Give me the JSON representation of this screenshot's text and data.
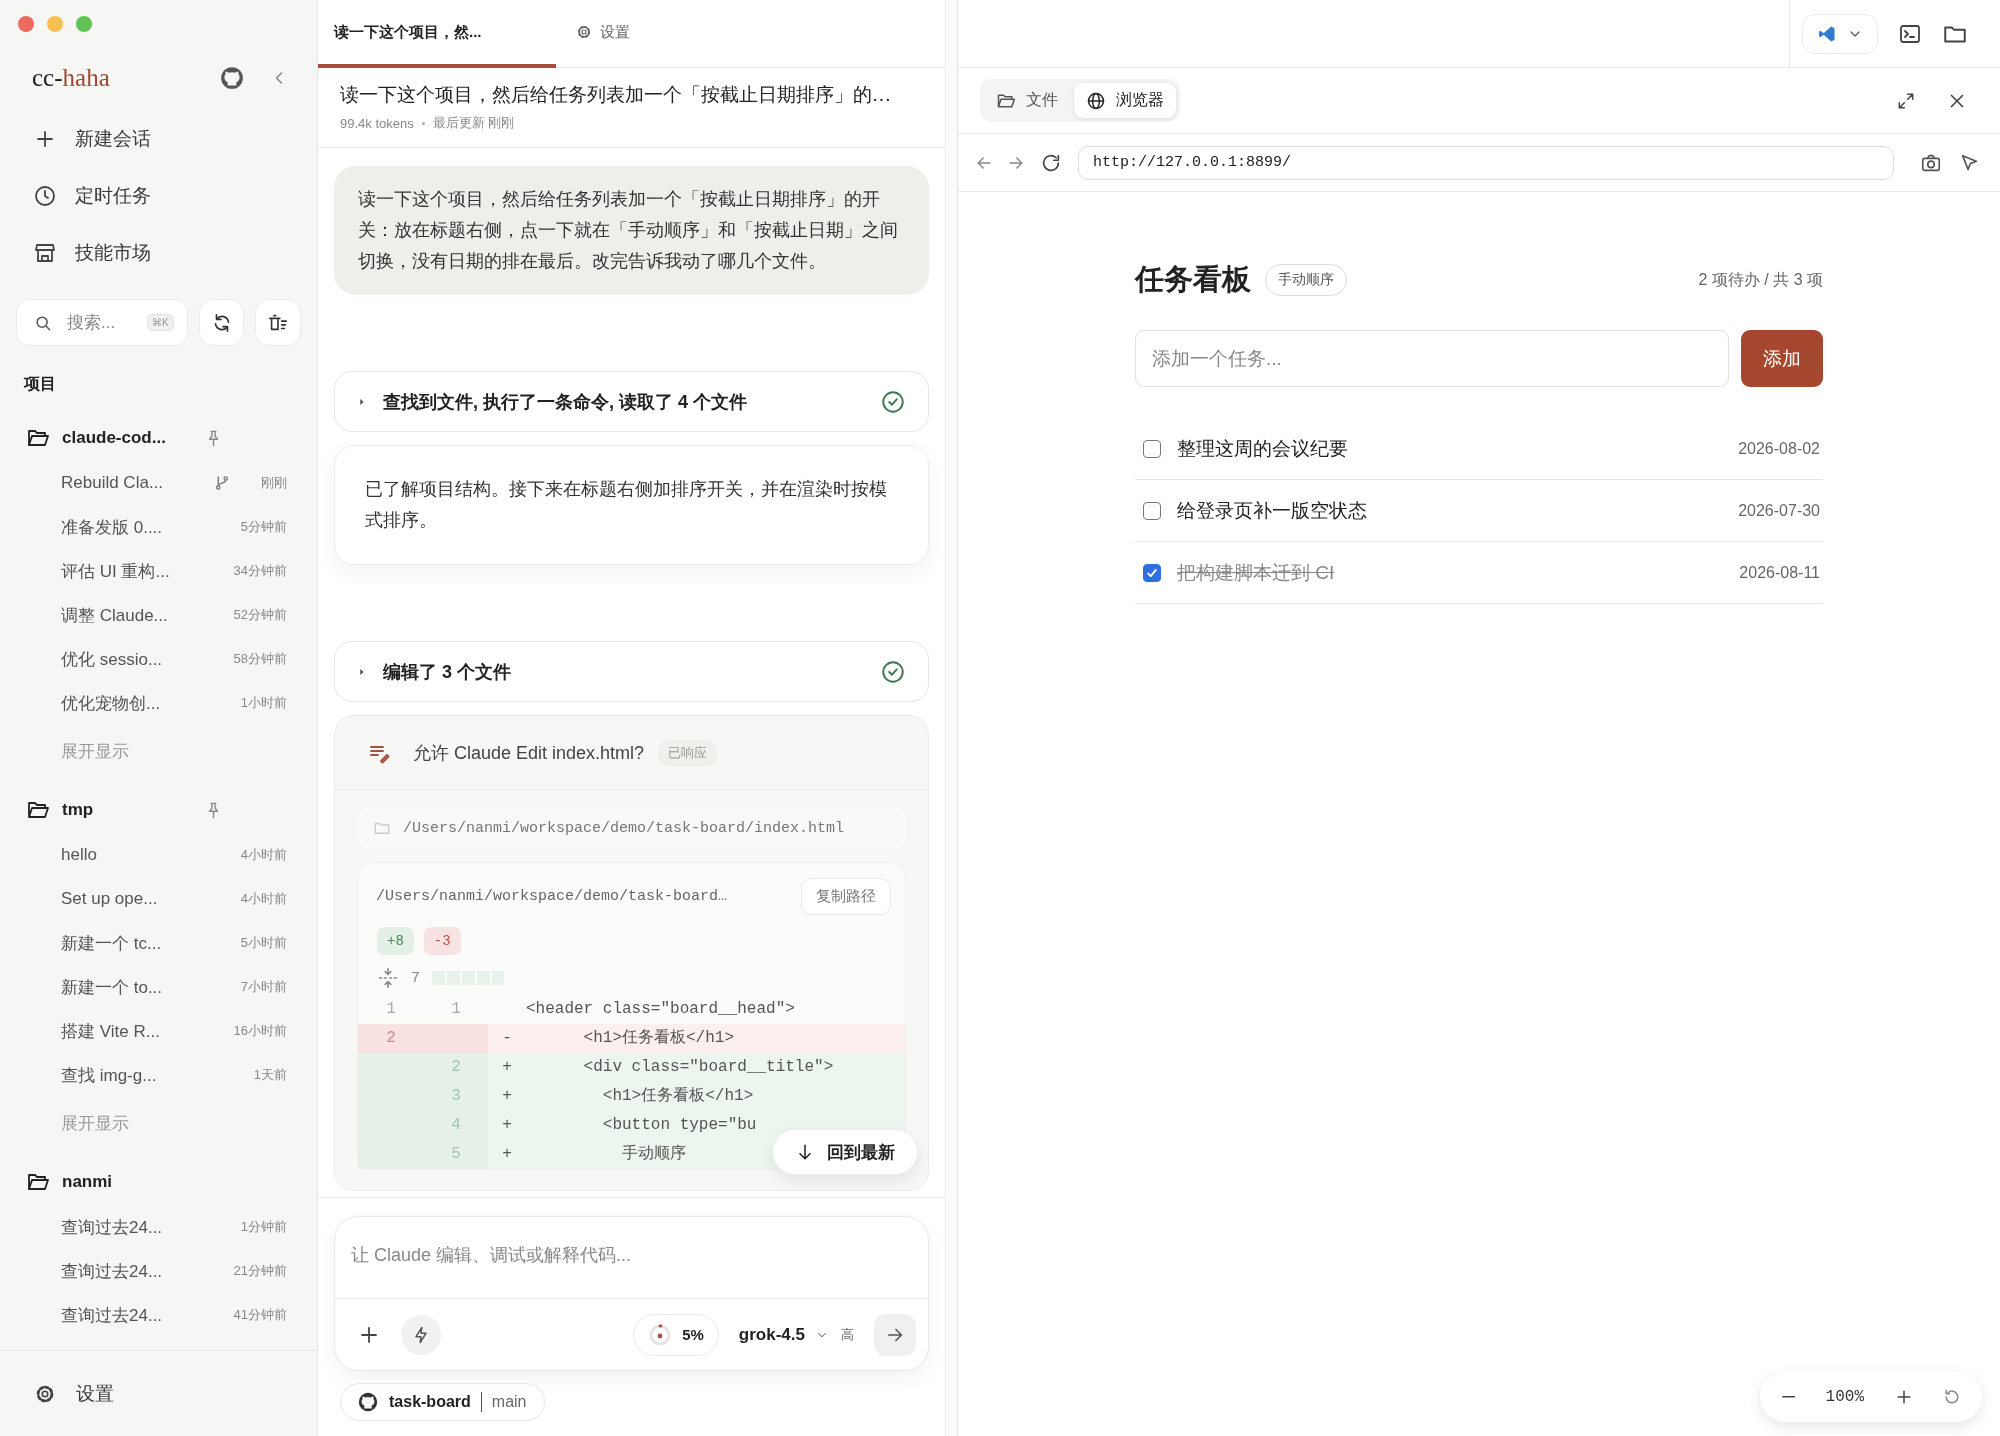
{
  "sidebar": {
    "brand": {
      "prefix": "cc-",
      "accent": "haha"
    },
    "nav": [
      {
        "kind": "new",
        "label": "新建会话"
      },
      {
        "kind": "schedule",
        "label": "定时任务"
      },
      {
        "kind": "market",
        "label": "技能市场"
      }
    ],
    "search": {
      "placeholder": "搜索...",
      "shortcut": "⌘K"
    },
    "section_title": "项目",
    "projects": [
      {
        "name": "claude-cod...",
        "pinned": true,
        "more": "展开显示",
        "sessions": [
          {
            "title": "Rebuild Cla...",
            "time": "刚刚",
            "branch": true
          },
          {
            "title": "准备发版 0....",
            "time": "5分钟前",
            "branch": false
          },
          {
            "title": "评估 UI 重构...",
            "time": "34分钟前",
            "branch": false
          },
          {
            "title": "调整 Claude...",
            "time": "52分钟前",
            "branch": false
          },
          {
            "title": "优化 sessio...",
            "time": "58分钟前",
            "branch": false
          },
          {
            "title": "优化宠物创...",
            "time": "1小时前",
            "branch": false
          }
        ]
      },
      {
        "name": "tmp",
        "pinned": true,
        "more": "展开显示",
        "sessions": [
          {
            "title": "hello",
            "time": "4小时前",
            "branch": false
          },
          {
            "title": "Set up ope...",
            "time": "4小时前",
            "branch": false
          },
          {
            "title": "新建一个 tc...",
            "time": "5小时前",
            "branch": false
          },
          {
            "title": "新建一个 to...",
            "time": "7小时前",
            "branch": false
          },
          {
            "title": "搭建 Vite R...",
            "time": "16小时前",
            "branch": false
          },
          {
            "title": "查找 img-g...",
            "time": "1天前",
            "branch": false
          }
        ]
      },
      {
        "name": "nanmi",
        "pinned": false,
        "sessions": [
          {
            "title": "查询过去24...",
            "time": "1分钟前",
            "branch": false
          },
          {
            "title": "查询过去24...",
            "time": "21分钟前",
            "branch": false
          },
          {
            "title": "查询过去24...",
            "time": "41分钟前",
            "branch": false
          }
        ]
      }
    ],
    "settings": "设置"
  },
  "tabs": [
    {
      "kind": "chat",
      "label": "读一下这个项目，然...",
      "selected": true
    },
    {
      "kind": "settings",
      "label": "设置",
      "selected": false
    }
  ],
  "chat": {
    "title": "读一下这个项目，然后给任务列表加一个「按截止日期排序」的…",
    "tokens": "99.4k tokens",
    "updated": "最后更新 刚刚",
    "messages": [
      {
        "kind": "user",
        "text": "读一下这个项目，然后给任务列表加一个「按截止日期排序」的开关：放在标题右侧，点一下就在「手动顺序」和「按截止日期」之间切换，没有日期的排在最后。改完告诉我动了哪几个文件。"
      },
      {
        "kind": "tool",
        "summary": "查找到文件, 执行了一条命令, 读取了 4 个文件",
        "done": true
      },
      {
        "kind": "assistant",
        "text": "已了解项目结构。接下来在标题右侧加排序开关，并在渲染时按模式排序。"
      },
      {
        "kind": "tool",
        "summary": "编辑了 3 个文件",
        "done": true
      },
      {
        "kind": "permission",
        "title": "允许 Claude Edit index.html?",
        "status": "已响应",
        "path": "/Users/nanmi/workspace/demo/task-board/index.html",
        "diff": {
          "path": "/Users/nanmi/workspace/demo/task-board…",
          "copy": "复制路径",
          "added": "+8",
          "removed": "-3",
          "hunk": "7",
          "lines": [
            {
              "kind": "context",
              "old": "1",
              "new": "1",
              "code": "<header class=\"board__head\">"
            },
            {
              "kind": "del",
              "old": "2",
              "sign": "-",
              "code": "      <h1>任务看板</h1>"
            },
            {
              "kind": "add",
              "new": "2",
              "sign": "+",
              "code": "      <div class=\"board__title\">"
            },
            {
              "kind": "add",
              "new": "3",
              "sign": "+",
              "code": "        <h1>任务看板</h1>"
            },
            {
              "kind": "add",
              "new": "4",
              "sign": "+",
              "code": "        <button type=\"bu"
            },
            {
              "kind": "add",
              "new": "5",
              "sign": "+",
              "code": "          手动顺序"
            }
          ]
        }
      }
    ],
    "jump": "回到最新"
  },
  "composer": {
    "placeholder": "让 Claude 编辑、调试或解释代码...",
    "context": "5%",
    "model": "grok-4.5",
    "effort": "高"
  },
  "repo": {
    "name": "task-board",
    "branch": "main"
  },
  "preview": {
    "tabs": [
      {
        "kind": "files",
        "label": "文件",
        "selected": false
      },
      {
        "kind": "browser",
        "label": "浏览器",
        "selected": true
      }
    ],
    "url": "http://127.0.0.1:8899/",
    "page": {
      "title": "任务看板",
      "sort": "手动顺序",
      "count": "2 项待办 / 共 3 项",
      "placeholder": "添加一个任务...",
      "add": "添加",
      "tasks": [
        {
          "text": "整理这周的会议纪要",
          "date": "2026-08-02",
          "checked": false
        },
        {
          "text": "给登录页补一版空状态",
          "date": "2026-07-30",
          "checked": false
        },
        {
          "text": "把构建脚本迁到 CI",
          "date": "2026-08-11",
          "checked": true
        }
      ]
    },
    "zoom": "100%"
  }
}
